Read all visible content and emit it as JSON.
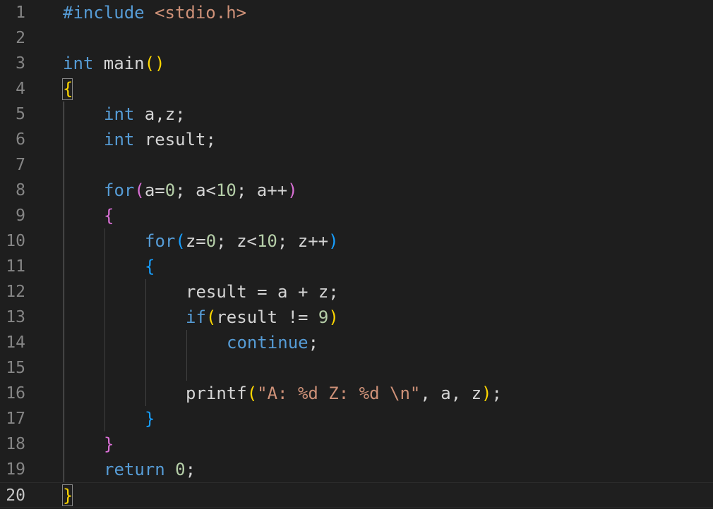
{
  "colors": {
    "background": "#1e1e1e",
    "keyword": "#569cd6",
    "control": "#c586c0",
    "function": "#dcdcaa",
    "variable": "#d4d4d4",
    "number": "#b5cea8",
    "string": "#ce9178",
    "bracket_gold": "#ffd700",
    "bracket_purple": "#da70d6",
    "bracket_blue": "#179fff",
    "line_number": "#858585",
    "line_number_active": "#c6c6c6"
  },
  "editor": {
    "language": "c",
    "current_line": 20,
    "lines": [
      {
        "n": "1",
        "indent": 0,
        "tokens": [
          {
            "t": "#include",
            "c": "#569cd6"
          },
          {
            "t": " ",
            "c": "#d4d4d4"
          },
          {
            "t": "<stdio.h>",
            "c": "#ce9178"
          }
        ]
      },
      {
        "n": "2",
        "indent": 0,
        "tokens": []
      },
      {
        "n": "3",
        "indent": 0,
        "tokens": [
          {
            "t": "int",
            "c": "#569cd6"
          },
          {
            "t": " main",
            "c": "#d4d4d4"
          },
          {
            "t": "()",
            "c": "#ffd700"
          }
        ]
      },
      {
        "n": "4",
        "indent": 0,
        "tokens": [
          {
            "t": "{",
            "c": "#ffd700"
          }
        ]
      },
      {
        "n": "5",
        "indent": 1,
        "tokens": [
          {
            "t": "int",
            "c": "#569cd6"
          },
          {
            "t": " a,z;",
            "c": "#d4d4d4"
          }
        ]
      },
      {
        "n": "6",
        "indent": 1,
        "tokens": [
          {
            "t": "int",
            "c": "#569cd6"
          },
          {
            "t": " result;",
            "c": "#d4d4d4"
          }
        ]
      },
      {
        "n": "7",
        "indent": 0,
        "tokens": []
      },
      {
        "n": "8",
        "indent": 1,
        "tokens": [
          {
            "t": "for",
            "c": "#569cd6"
          },
          {
            "t": "(",
            "c": "#da70d6"
          },
          {
            "t": "a=",
            "c": "#d4d4d4"
          },
          {
            "t": "0",
            "c": "#b5cea8"
          },
          {
            "t": "; a<",
            "c": "#d4d4d4"
          },
          {
            "t": "10",
            "c": "#b5cea8"
          },
          {
            "t": "; a++",
            "c": "#d4d4d4"
          },
          {
            "t": ")",
            "c": "#da70d6"
          }
        ]
      },
      {
        "n": "9",
        "indent": 1,
        "tokens": [
          {
            "t": "{",
            "c": "#da70d6"
          }
        ]
      },
      {
        "n": "10",
        "indent": 2,
        "tokens": [
          {
            "t": "for",
            "c": "#569cd6"
          },
          {
            "t": "(",
            "c": "#179fff"
          },
          {
            "t": "z=",
            "c": "#d4d4d4"
          },
          {
            "t": "0",
            "c": "#b5cea8"
          },
          {
            "t": "; z<",
            "c": "#d4d4d4"
          },
          {
            "t": "10",
            "c": "#b5cea8"
          },
          {
            "t": "; z++",
            "c": "#d4d4d4"
          },
          {
            "t": ")",
            "c": "#179fff"
          }
        ]
      },
      {
        "n": "11",
        "indent": 2,
        "tokens": [
          {
            "t": "{",
            "c": "#179fff"
          }
        ]
      },
      {
        "n": "12",
        "indent": 3,
        "tokens": [
          {
            "t": "result = a + z;",
            "c": "#d4d4d4"
          }
        ]
      },
      {
        "n": "13",
        "indent": 3,
        "tokens": [
          {
            "t": "if",
            "c": "#569cd6"
          },
          {
            "t": "(",
            "c": "#ffd700"
          },
          {
            "t": "result != ",
            "c": "#d4d4d4"
          },
          {
            "t": "9",
            "c": "#b5cea8"
          },
          {
            "t": ")",
            "c": "#ffd700"
          }
        ]
      },
      {
        "n": "14",
        "indent": 4,
        "tokens": [
          {
            "t": "continue",
            "c": "#569cd6"
          },
          {
            "t": ";",
            "c": "#d4d4d4"
          }
        ]
      },
      {
        "n": "15",
        "indent": 0,
        "tokens": []
      },
      {
        "n": "16",
        "indent": 3,
        "tokens": [
          {
            "t": "printf",
            "c": "#d4d4d4"
          },
          {
            "t": "(",
            "c": "#ffd700"
          },
          {
            "t": "\"A: %d Z: %d \\n\"",
            "c": "#ce9178"
          },
          {
            "t": ", a, z",
            "c": "#d4d4d4"
          },
          {
            "t": ")",
            "c": "#ffd700"
          },
          {
            "t": ";",
            "c": "#d4d4d4"
          }
        ]
      },
      {
        "n": "17",
        "indent": 2,
        "tokens": [
          {
            "t": "}",
            "c": "#179fff"
          }
        ]
      },
      {
        "n": "18",
        "indent": 1,
        "tokens": [
          {
            "t": "}",
            "c": "#da70d6"
          }
        ]
      },
      {
        "n": "19",
        "indent": 1,
        "tokens": [
          {
            "t": "return",
            "c": "#569cd6"
          },
          {
            "t": " ",
            "c": "#d4d4d4"
          },
          {
            "t": "0",
            "c": "#b5cea8"
          },
          {
            "t": ";",
            "c": "#d4d4d4"
          }
        ]
      },
      {
        "n": "20",
        "indent": 0,
        "tokens": [
          {
            "t": "}",
            "c": "#ffd700"
          }
        ]
      }
    ]
  }
}
